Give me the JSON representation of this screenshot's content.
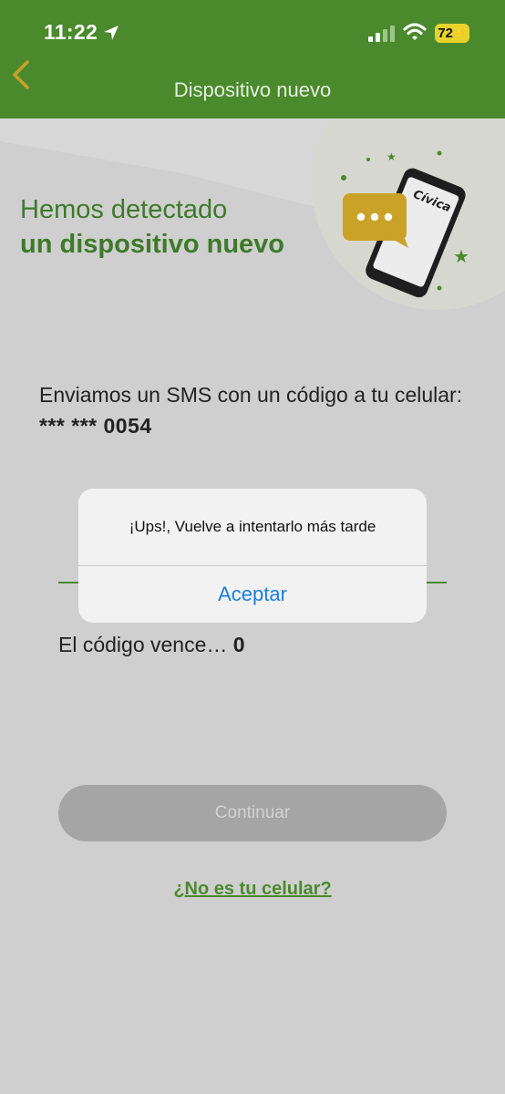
{
  "status": {
    "time": "11:22",
    "battery": "72"
  },
  "header": {
    "title": "Dispositivo nuevo"
  },
  "hero": {
    "line1": "Hemos detectado",
    "line2": "un dispositivo nuevo",
    "phone_brand": "Cívica"
  },
  "body": {
    "sms_prefix": "Enviamos un SMS con un código a tu celular: ",
    "masked_phone": "*** *** 0054",
    "expire_label": "El código vence… ",
    "expire_value": "0"
  },
  "actions": {
    "continue_label": "Continuar",
    "not_phone_link": "¿No es tu celular?"
  },
  "alert": {
    "message": "¡Ups!, Vuelve a intentarlo más tarde",
    "accept_label": "Aceptar"
  },
  "colors": {
    "brand_green": "#4a8a2c",
    "accent_gold": "#c9a227",
    "link_blue": "#1a7ee0"
  }
}
